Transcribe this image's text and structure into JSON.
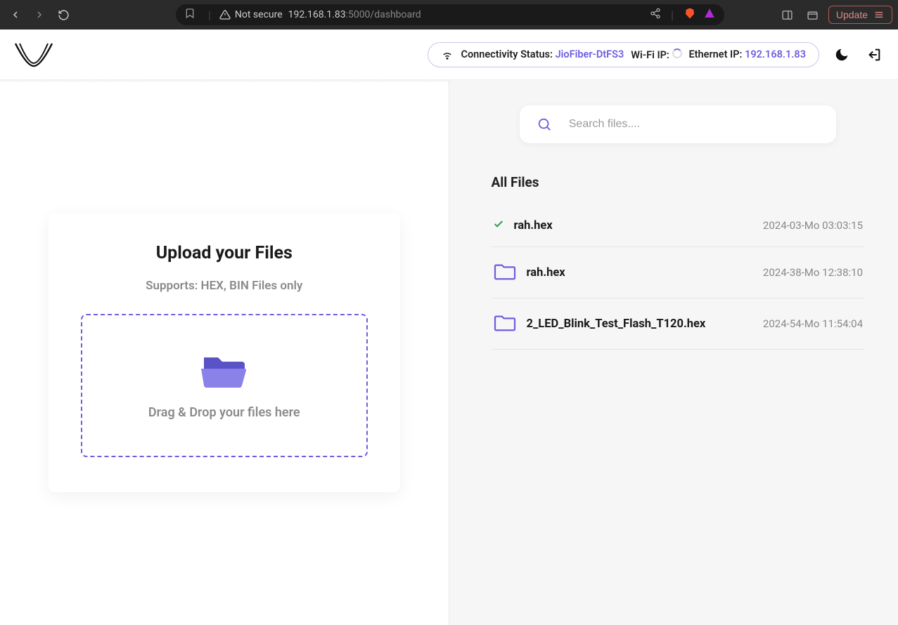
{
  "browser": {
    "not_secure_label": "Not secure",
    "url_host": "192.168.1.83",
    "url_port_path": ":5000/dashboard",
    "update_label": "Update"
  },
  "header": {
    "connectivity_label": "Connectivity Status:",
    "connectivity_value": "JioFiber-DtFS3",
    "wifi_label": "Wi-Fi IP:",
    "ethernet_label": "Ethernet IP:",
    "ethernet_value": "192.168.1.83"
  },
  "upload": {
    "title": "Upload your Files",
    "subtitle": "Supports: HEX, BIN Files only",
    "drop_text": "Drag & Drop your files here"
  },
  "search": {
    "placeholder": "Search files...."
  },
  "files": {
    "section_title": "All Files",
    "items": [
      {
        "name": "rah.hex",
        "date": "2024-03-Mo 03:03:15",
        "status": "done"
      },
      {
        "name": "rah.hex",
        "date": "2024-38-Mo 12:38:10",
        "status": "folder"
      },
      {
        "name": "2_LED_Blink_Test_Flash_T120.hex",
        "date": "2024-54-Mo 11:54:04",
        "status": "folder"
      }
    ]
  }
}
